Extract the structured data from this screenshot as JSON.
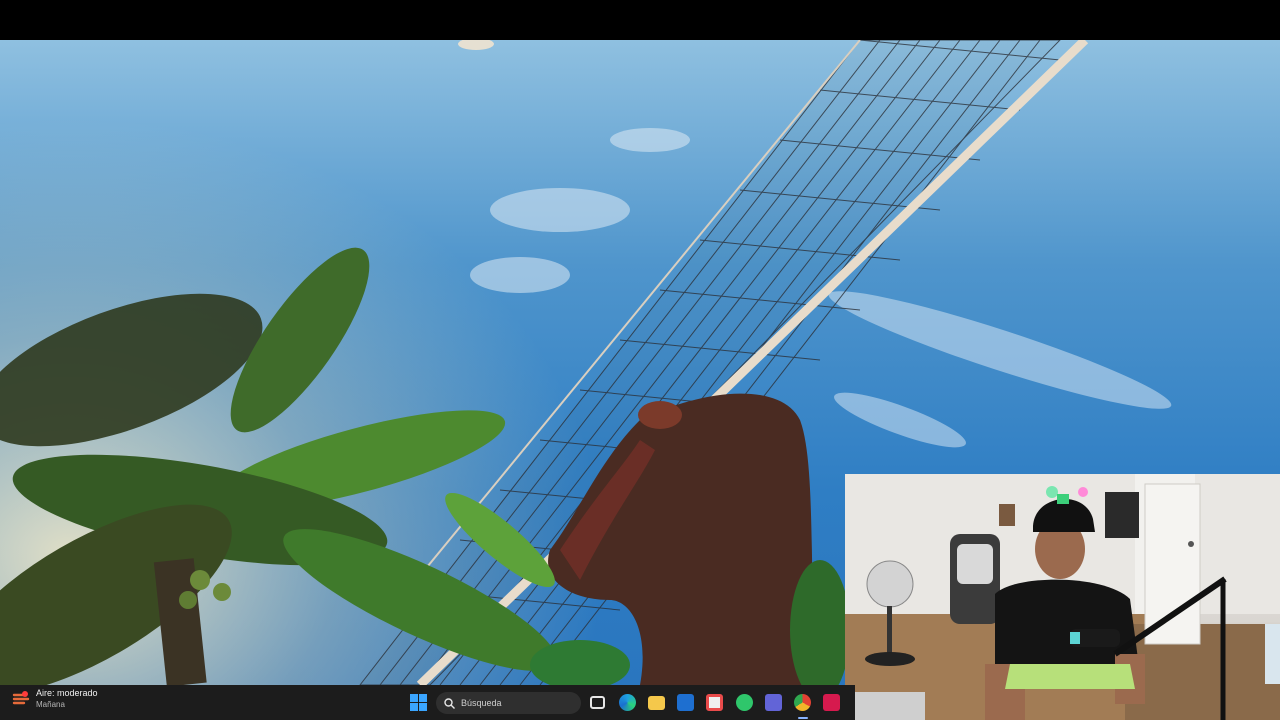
{
  "taskbar": {
    "weather": {
      "title": "Aire: moderado",
      "subtitle": "Mañana",
      "icon": "air-quality-icon"
    },
    "search": {
      "placeholder": "Búsqueda"
    },
    "apps": [
      {
        "name": "task-view",
        "icon": "task-view-icon",
        "color": "#e6e6e6"
      },
      {
        "name": "edge",
        "icon": "edge-icon",
        "color": "#2aa8e0"
      },
      {
        "name": "file-explorer",
        "icon": "folder-icon",
        "color": "#f5c84b"
      },
      {
        "name": "outlook",
        "icon": "outlook-icon",
        "color": "#1e6fd0"
      },
      {
        "name": "store",
        "icon": "store-icon",
        "color": "#e94b4b"
      },
      {
        "name": "whatsapp",
        "icon": "whatsapp-icon",
        "color": "#2fc66b"
      },
      {
        "name": "teams",
        "icon": "teams-icon",
        "color": "#6264d7"
      },
      {
        "name": "chrome",
        "icon": "chrome-icon",
        "color": "#e3b32a"
      },
      {
        "name": "tiktok",
        "icon": "tiktok-icon",
        "color": "#d61a4e"
      }
    ]
  },
  "colors": {
    "sky_top": "#8fc0e0",
    "sky_bottom": "#2a76bf",
    "taskbar_bg": "#1c1c1c",
    "accent": "#3aa5ff"
  }
}
